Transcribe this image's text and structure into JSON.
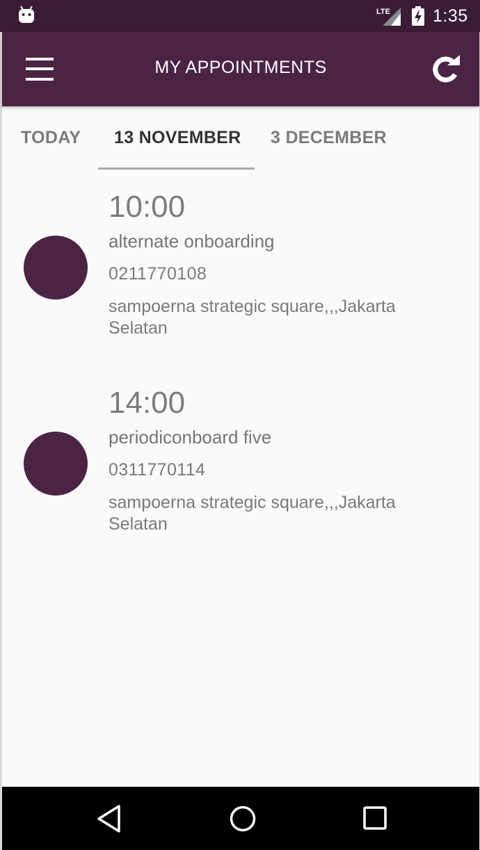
{
  "status_bar": {
    "network": "LTE",
    "time": "1:35"
  },
  "app_bar": {
    "title": "MY APPOINTMENTS",
    "menu_icon": "hamburger-menu-icon",
    "refresh_icon": "refresh-icon"
  },
  "tabs": [
    {
      "label": "TODAY",
      "active": false
    },
    {
      "label": "13 NOVEMBER",
      "active": true
    },
    {
      "label": "3 DECEMBER",
      "active": false
    }
  ],
  "appointments": [
    {
      "time": "10:00",
      "name": "alternate onboarding",
      "phone": "0211770108",
      "address": "sampoerna strategic square,,,Jakarta Selatan"
    },
    {
      "time": "14:00",
      "name": "periodiconboard five",
      "phone": "0311770114",
      "address": "sampoerna strategic square,,,Jakarta Selatan"
    }
  ],
  "nav_bar": {
    "back_icon": "back-triangle-icon",
    "home_icon": "home-circle-icon",
    "recents_icon": "recents-square-icon"
  },
  "colors": {
    "status_bar": "#3a1d35",
    "app_bar": "#4b2445",
    "avatar": "#4b2445",
    "background": "#fafafa"
  }
}
